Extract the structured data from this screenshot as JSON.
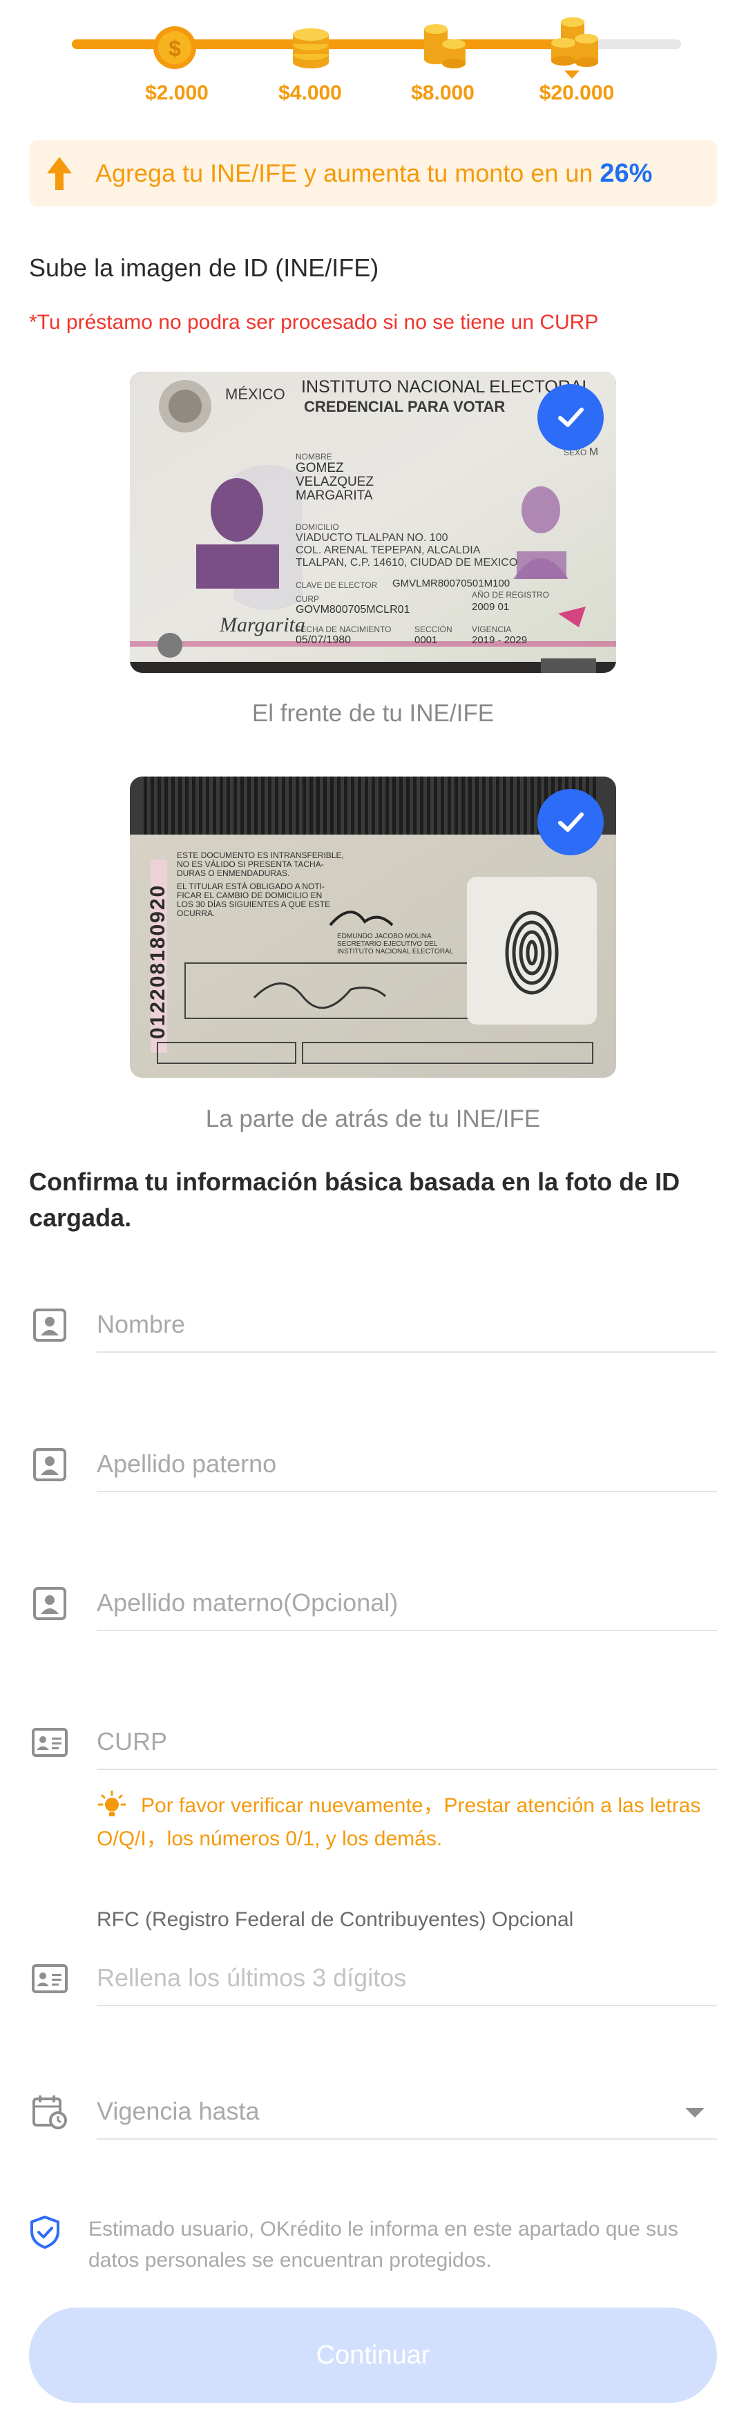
{
  "progress": {
    "level": 0.8,
    "current_step": 4,
    "steps": [
      {
        "label": "$2.000",
        "icon": "coin-icon"
      },
      {
        "label": "$4.000",
        "icon": "coin-stack-icon"
      },
      {
        "label": "$8.000",
        "icon": "coin-stacks-icon"
      },
      {
        "label": "$20.000",
        "icon": "coin-pile-icon"
      }
    ],
    "colors": {
      "fill": "#f59a0c",
      "track": "#e7e7e7"
    }
  },
  "banner": {
    "icon": "arrow-up-icon",
    "text": "Agrega tu INE/IFE y aumenta tu monto en un",
    "percent": "26%"
  },
  "upload": {
    "title": "Sube la imagen de ID (INE/IFE)",
    "warning": "*Tu préstamo no podra ser procesado si no se tiene un CURP",
    "front": {
      "caption": "El frente de tu INE/IFE",
      "card_country": "MÉXICO",
      "card_institute": "INSTITUTO NACIONAL ELECTORAL",
      "card_type": "CREDENCIAL PARA VOTAR",
      "sex_label": "SEXO",
      "sex_value": "M",
      "name_label": "NOMBRE",
      "name_lines": [
        "GOMEZ",
        "VELAZQUEZ",
        "MARGARITA"
      ],
      "address_label": "DOMICILIO",
      "address_lines": [
        "VIADUCTO TLALPAN NO. 100",
        "COL. ARENAL TEPEPAN, ALCALDIA",
        "TLALPAN, C.P. 14610, CIUDAD DE MEXICO"
      ],
      "elector_key_label": "CLAVE DE ELECTOR",
      "elector_key": "GMVLMR80070501M100",
      "curp_label": "CURP",
      "curp": "GOVM800705MCLR01",
      "registro_label": "AÑO DE REGISTRO",
      "registro": "2009 01",
      "birth_label": "FECHA DE NACIMIENTO",
      "birth": "05/07/1980",
      "section_label": "SECCIÓN",
      "section": "0001",
      "vigencia_label": "VIGENCIA",
      "vigencia": "2019 - 2029",
      "signature": "Margarita",
      "check_icon": "check-icon"
    },
    "back": {
      "caption": "La parte de atrás de tu INE/IFE",
      "id_number": "012208180920",
      "notice_lines": [
        "ESTE DOCUMENTO ES INTRANSFERIBLE,",
        "NO ES VÁLIDO SI PRESENTA TACHA-",
        "DURAS O ENMENDADURAS.",
        "EL TITULAR ESTÁ OBLIGADO A NOTI-",
        "FICAR EL CAMBIO DE DOMICILIO EN",
        "LOS 30 DÍAS SIGUIENTES A QUE ESTE",
        "OCURRA."
      ],
      "secretary_lines": [
        "EDMUNDO JACOBO MOLINA",
        "SECRETARIO EJECUTIVO DEL",
        "INSTITUTO NACIONAL ELECTORAL"
      ],
      "check_icon": "check-icon"
    }
  },
  "form": {
    "title": "Confirma tu información básica basada en la foto de ID cargada.",
    "fields": [
      {
        "placeholder": "Nombre",
        "icon": "person-icon"
      },
      {
        "placeholder": "Apellido paterno",
        "icon": "person-icon"
      },
      {
        "placeholder": "Apellido materno(Opcional)",
        "icon": "person-icon"
      },
      {
        "placeholder": "CURP",
        "icon": "id-card-icon"
      }
    ],
    "curp_hint": "Por favor verificar nuevamente，Prestar atención a las letras O/Q/I，los números 0/1, y los demás.",
    "curp_hint_icon": "lightbulb-icon",
    "rfc": {
      "label": "RFC (Registro Federal de Contribuyentes) Opcional",
      "placeholder": "Rellena los últimos 3 dígitos",
      "icon": "id-card-icon"
    },
    "vigencia": {
      "placeholder": "Vigencia hasta",
      "icon": "calendar-clock-icon",
      "dropdown_icon": "caret-down-icon"
    }
  },
  "privacy": {
    "icon": "shield-check-icon",
    "text": "Estimado usuario, OKrédito le informa en este apartado que sus datos personales se encuentran protegidos."
  },
  "cta": {
    "label": "Continuar",
    "color": "#d2e0fd"
  }
}
